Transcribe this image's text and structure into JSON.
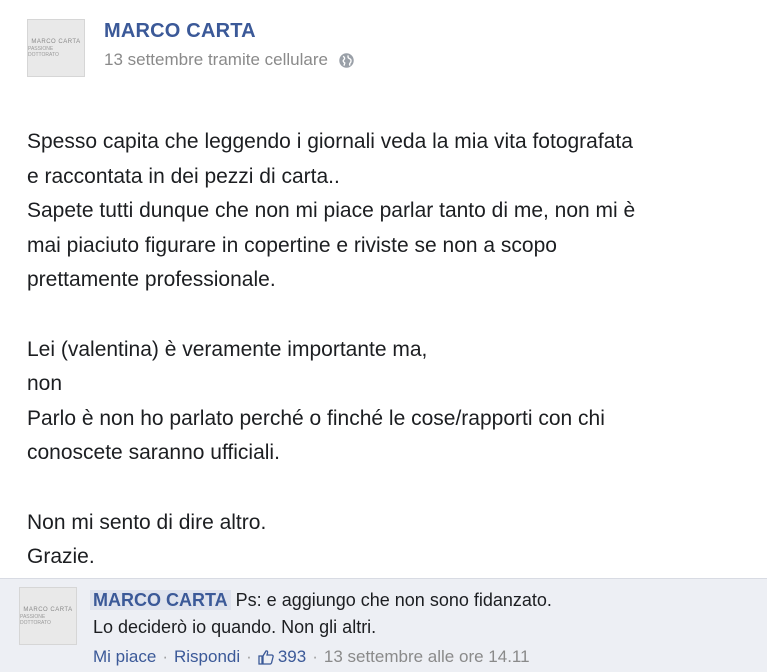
{
  "post": {
    "author": "MARCO CARTA",
    "meta": "13 settembre tramite cellulare",
    "avatar_logo_line1": "MARCO CARTA",
    "avatar_logo_line2": "PASSIONE DOTTORATO",
    "body": "Spesso capita che leggendo i giornali veda la mia vita fotografata\ne raccontata in dei pezzi di carta..\nSapete tutti dunque che non mi piace parlar tanto di me, non mi è\nmai piaciuto figurare in copertine e riviste se non a scopo\nprettamente professionale.\n\nLei (valentina) è veramente importante ma,\nnon\nParlo è non ho parlato perché o finché le cose/rapporti con chi\nconoscete saranno ufficiali.\n\nNon mi sento di dire altro.\nGrazie."
  },
  "comment": {
    "author": "MARCO CARTA",
    "text_line1": "Ps: e aggiungo che non sono fidanzato.",
    "text_line2": "Lo deciderò io quando. Non gli altri.",
    "like_label": "Mi piace",
    "reply_label": "Rispondi",
    "like_count": "393",
    "timestamp": "13 settembre alle ore 14.11",
    "separator": "·"
  },
  "icons": {
    "privacy": "globe-icon",
    "like": "thumbs-up-icon"
  },
  "colors": {
    "link": "#3b5998",
    "meta": "#8a8a8a",
    "comment_bg": "#edeff4"
  }
}
